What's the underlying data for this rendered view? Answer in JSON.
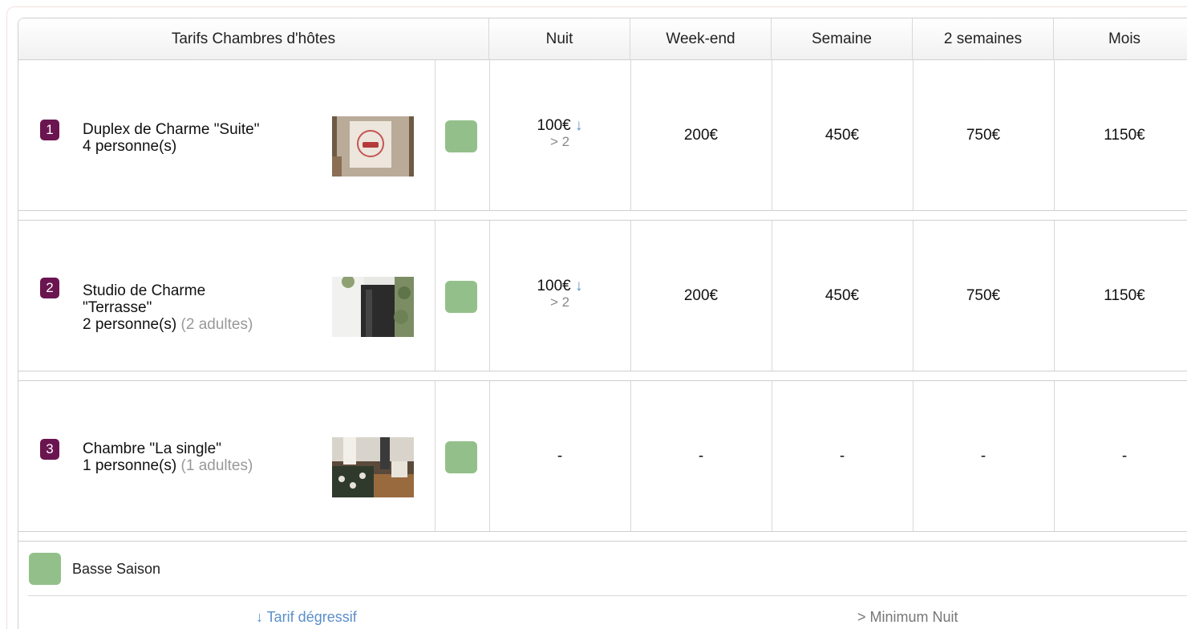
{
  "header": {
    "title": "Tarifs Chambres d'hôtes",
    "columns": [
      "Nuit",
      "Week-end",
      "Semaine",
      "2 semaines",
      "Mois"
    ]
  },
  "rooms": [
    {
      "number": "1",
      "name": "Duplex de Charme \"Suite\"",
      "capacity": "4 personne(s)",
      "adults": "",
      "season_color": "#93c08a",
      "night": {
        "price": "100€",
        "arrow": "↓",
        "min": "> 2"
      },
      "weekend": "200€",
      "week": "450€",
      "two_weeks": "750€",
      "month": "1150€"
    },
    {
      "number": "2",
      "name": "Studio de Charme \"Terrasse\"",
      "capacity": "2 personne(s)",
      "adults": "(2 adultes)",
      "season_color": "#93c08a",
      "night": {
        "price": "100€",
        "arrow": "↓",
        "min": "> 2"
      },
      "weekend": "200€",
      "week": "450€",
      "two_weeks": "750€",
      "month": "1150€"
    },
    {
      "number": "3",
      "name": "Chambre \"La single\"",
      "capacity": "1 personne(s)",
      "adults": "(1 adultes)",
      "season_color": "#93c08a",
      "night": {
        "price": "-",
        "arrow": "",
        "min": ""
      },
      "weekend": "-",
      "week": "-",
      "two_weeks": "-",
      "month": "-"
    }
  ],
  "legend": {
    "season_label": "Basse Saison",
    "season_color": "#93c08a",
    "degressive": "↓ Tarif dégressif",
    "min_nights": "> Minimum Nuit"
  },
  "colors": {
    "badge": "#6b1550",
    "accent_blue": "#5b8fc9"
  }
}
